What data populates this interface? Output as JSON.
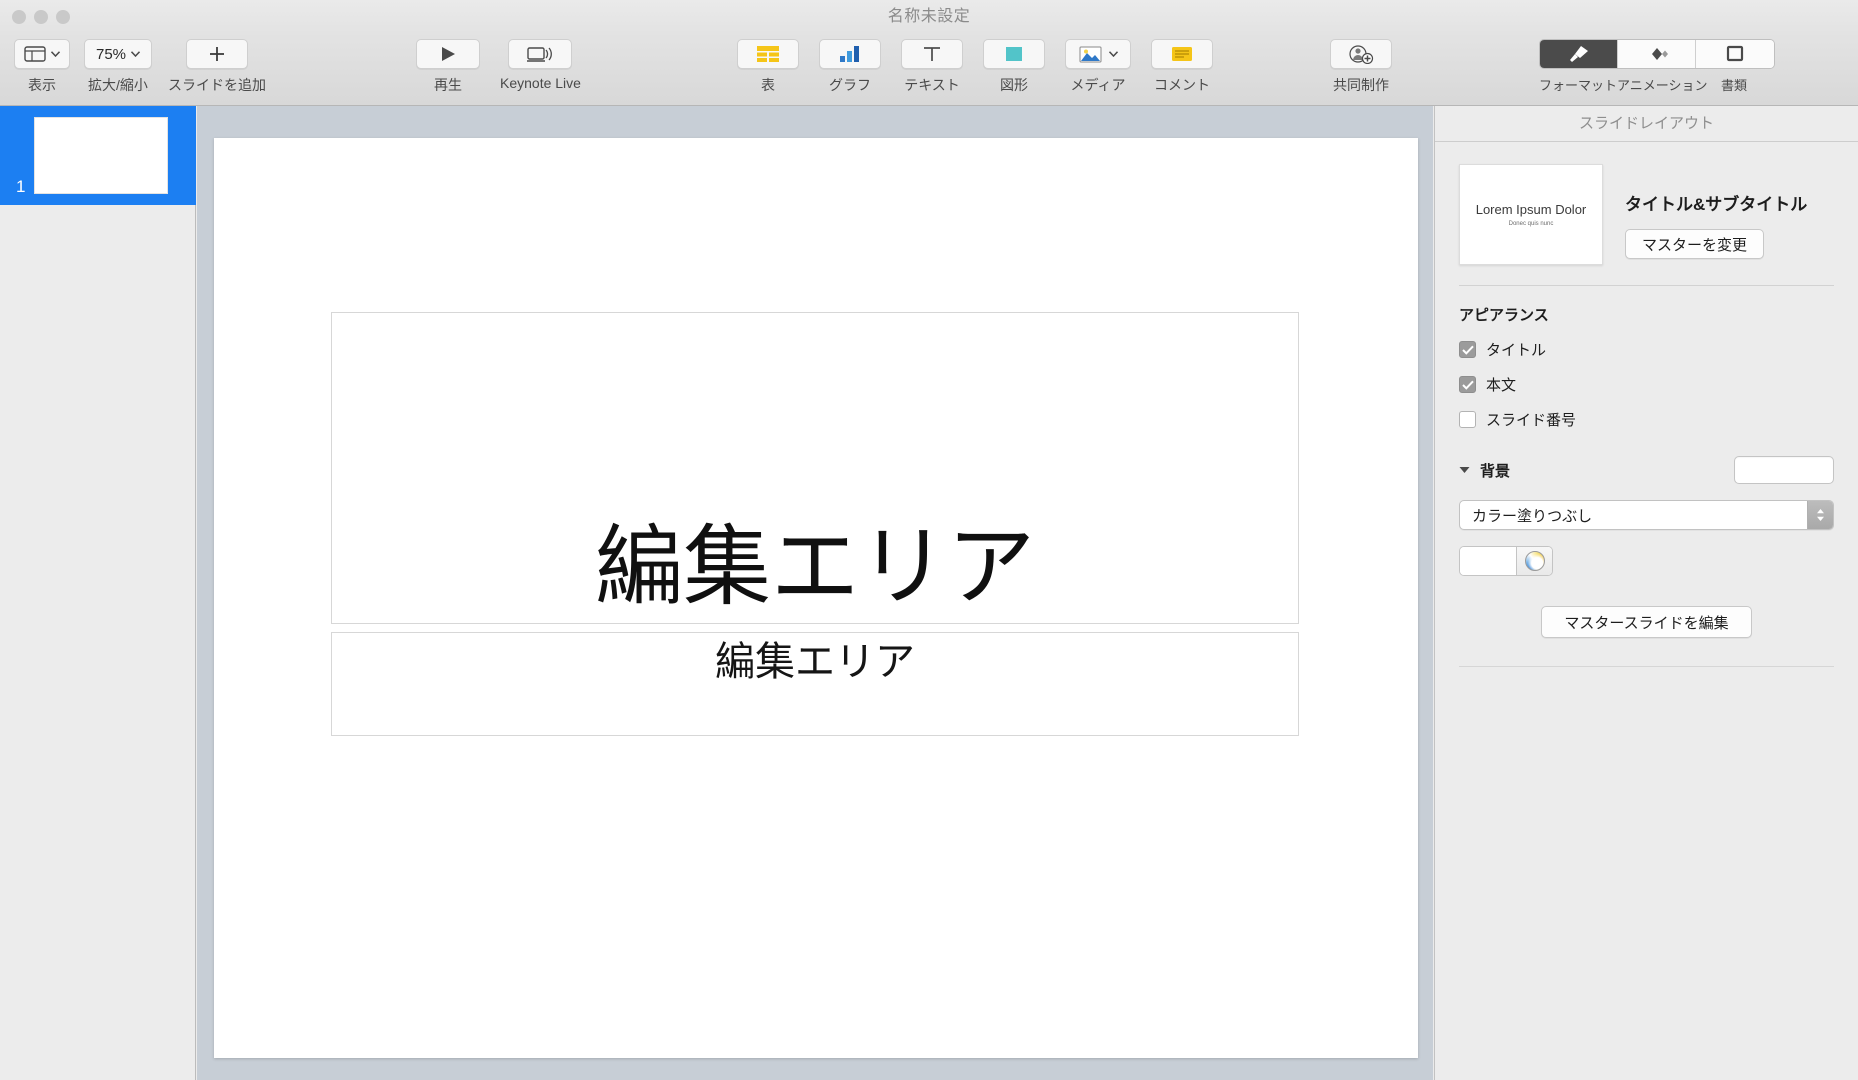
{
  "window": {
    "title": "名称未設定",
    "traffic_lights": [
      "close",
      "minimize",
      "zoom"
    ]
  },
  "toolbar": {
    "view": {
      "label": "表示",
      "icon": "view-layout-icon",
      "has_chevron": true
    },
    "zoom": {
      "label": "拡大/縮小",
      "value": "75%",
      "has_chevron": true
    },
    "add_slide": {
      "label": "スライドを追加",
      "icon": "plus-icon"
    },
    "play": {
      "label": "再生",
      "icon": "play-icon"
    },
    "keynote_live": {
      "label": "Keynote Live",
      "icon": "display-broadcast-icon"
    },
    "table": {
      "label": "表",
      "icon": "table-icon"
    },
    "chart": {
      "label": "グラフ",
      "icon": "bar-chart-icon"
    },
    "text": {
      "label": "テキスト",
      "icon": "text-t-icon"
    },
    "shape": {
      "label": "図形",
      "icon": "shape-square-icon"
    },
    "media": {
      "label": "メディア",
      "icon": "photo-icon",
      "has_chevron": true
    },
    "comment": {
      "label": "コメント",
      "icon": "comment-note-icon"
    },
    "collaborate": {
      "label": "共同制作",
      "icon": "person-add-icon"
    },
    "segments": [
      {
        "label": "フォーマット",
        "icon": "paintbrush-icon",
        "selected": true
      },
      {
        "label": "アニメーション",
        "icon": "diamond-animate-icon",
        "selected": false
      },
      {
        "label": "書類",
        "icon": "document-rect-icon",
        "selected": false
      }
    ]
  },
  "navigator": {
    "slides": [
      {
        "number": "1",
        "selected": true
      }
    ]
  },
  "canvas": {
    "slide": {
      "title_placeholder": "編集エリア",
      "body_placeholder": "編集エリア"
    }
  },
  "inspector": {
    "header": "スライドレイアウト",
    "layout": {
      "thumb_title": "Lorem Ipsum Dolor",
      "thumb_subtitle": "Donec quis nunc",
      "name": "タイトル&サブタイトル",
      "change_master_button": "マスターを変更"
    },
    "appearance": {
      "title": "アピアランス",
      "options": [
        {
          "label": "タイトル",
          "checked": true
        },
        {
          "label": "本文",
          "checked": true
        },
        {
          "label": "スライド番号",
          "checked": false
        }
      ]
    },
    "background": {
      "title": "背景",
      "expanded": true,
      "preview_color": "#ffffff",
      "fill_type": "カラー塗りつぶし",
      "fill_color": "#ffffff",
      "color_wheel_icon": "color-wheel-icon"
    },
    "edit_master_button": "マスタースライドを編集"
  },
  "colors": {
    "selection_blue": "#1c7ff2",
    "canvas_bg": "#c7ced6",
    "panel_bg": "#ececec",
    "toolbar_bg": "#dedede",
    "accent_yellow": "#f5c518",
    "accent_teal": "#52c4c9"
  }
}
